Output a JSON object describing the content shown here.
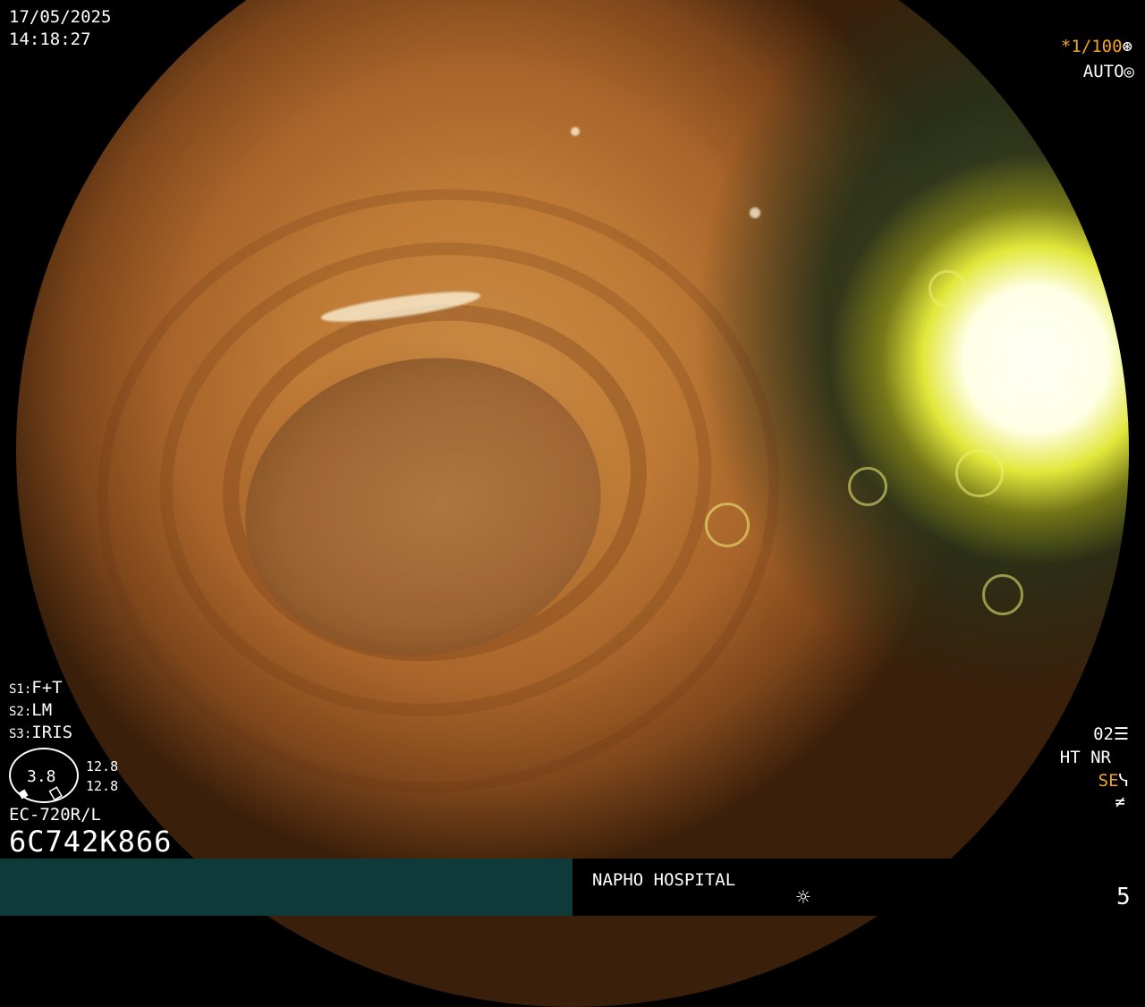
{
  "overlay": {
    "date": "17/05/2025",
    "time": "14:18:27",
    "shutter": "*1/100",
    "auto_mode": "AUTO",
    "settings": [
      {
        "key": "S1:",
        "value": "F+T"
      },
      {
        "key": "S2:",
        "value": "LM"
      },
      {
        "key": "S3:",
        "value": "IRIS"
      }
    ],
    "zoom_value": "3.8",
    "gauge_top": "12.8",
    "gauge_bottom": "12.8",
    "scope_model": "EC-720R/L",
    "scope_serial": "6C742K866",
    "right_panel": {
      "o2": "02",
      "ht_nr": "HT NR",
      "se": "SE",
      "mode_symbol": "≠"
    }
  },
  "status_bar": {
    "hospital": "NAPHO HOSPITAL",
    "page_number": "5"
  },
  "colors": {
    "accent": "#f5a623",
    "status_left": "#0f3a3a"
  },
  "icons": {
    "shutter": "aperture-icon",
    "auto": "iris-icon",
    "o2": "list-icon",
    "se": "scope-icon",
    "brightness": "sun-icon"
  }
}
